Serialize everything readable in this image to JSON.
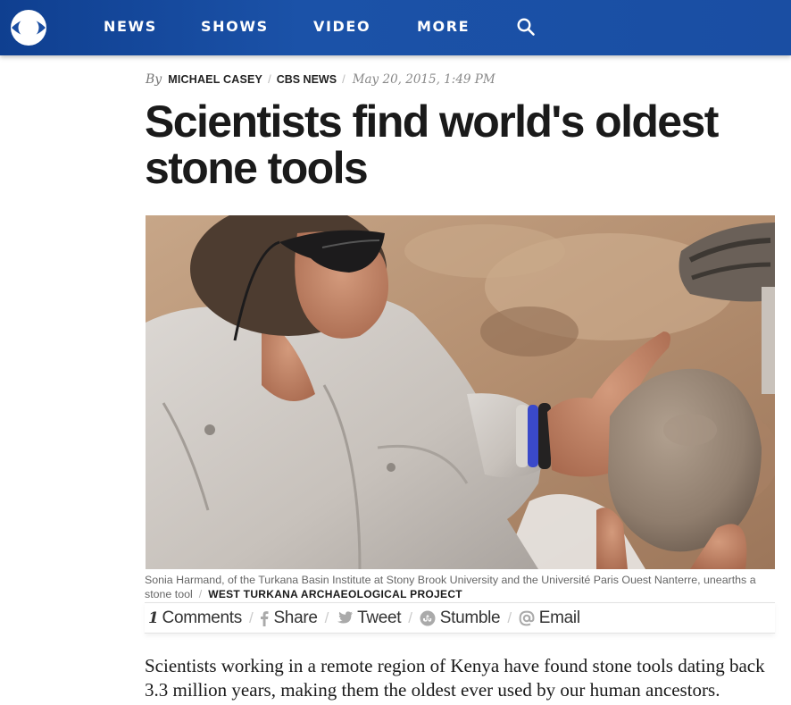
{
  "nav": {
    "items": [
      "NEWS",
      "SHOWS",
      "VIDEO",
      "MORE"
    ],
    "logo_icon": "cbs-eye-logo-icon",
    "search_icon": "search-icon",
    "background_color": "#1a4ea3"
  },
  "article": {
    "byline": {
      "by": "By",
      "author": "MICHAEL CASEY",
      "outlet": "CBS NEWS",
      "date": "May 20, 2015, 1:49 PM"
    },
    "headline": "Scientists find world's oldest stone tools",
    "photo": {
      "description_icon": "archaeologist-photo",
      "caption": "Sonia Harmand, of the Turkana Basin Institute at Stony Brook University and the Université Paris Ouest Nanterre, unearths a stone tool",
      "credit": "WEST TURKANA ARCHAEOLOGICAL PROJECT"
    },
    "share": {
      "comments_count": "1",
      "comments_label": "Comments",
      "share_label": "Share",
      "tweet_label": "Tweet",
      "stumble_label": "Stumble",
      "email_label": "Email",
      "icons": [
        "facebook-icon",
        "twitter-icon",
        "stumbleupon-icon",
        "email-icon"
      ]
    },
    "lede": "Scientists working in a remote region of Kenya have found stone tools dating back 3.3 million years, making them the oldest ever used by our human ancestors."
  }
}
